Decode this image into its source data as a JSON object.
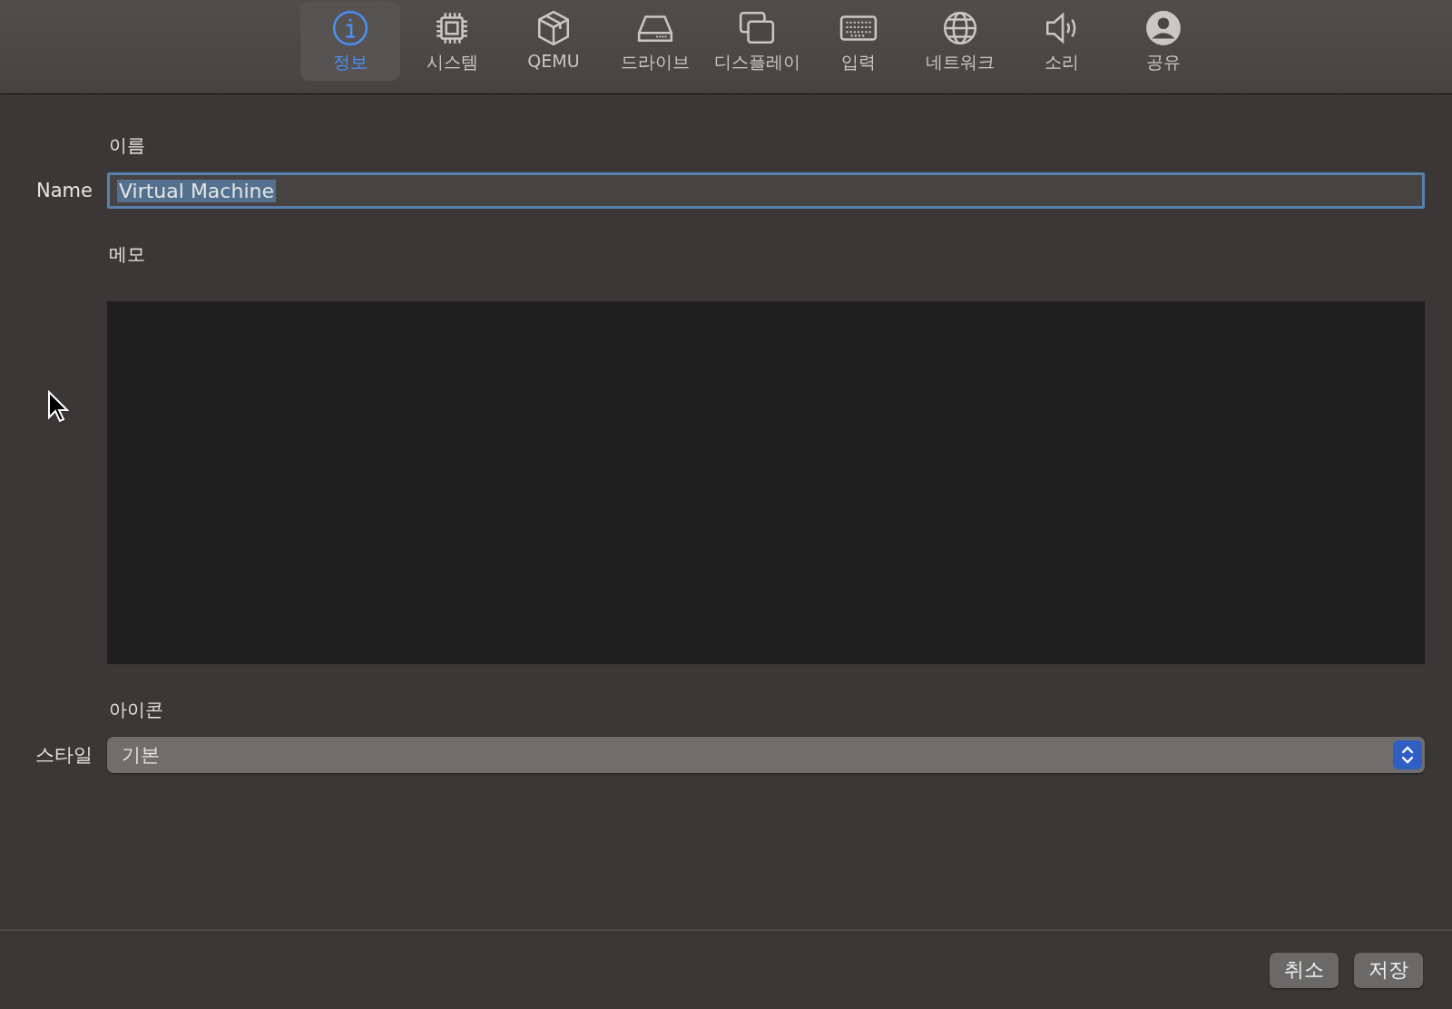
{
  "toolbar": {
    "tabs": [
      {
        "label": "정보",
        "selected": true
      },
      {
        "label": "시스템",
        "selected": false
      },
      {
        "label": "QEMU",
        "selected": false
      },
      {
        "label": "드라이브",
        "selected": false
      },
      {
        "label": "디스플레이",
        "selected": false
      },
      {
        "label": "입력",
        "selected": false
      },
      {
        "label": "네트워크",
        "selected": false
      },
      {
        "label": "소리",
        "selected": false
      },
      {
        "label": "공유",
        "selected": false
      }
    ]
  },
  "sections": [
    {
      "kind": "text",
      "heading": "이름",
      "label": "Name",
      "value": "Virtual Machine",
      "focused": true,
      "text_selected": true
    },
    {
      "kind": "memo",
      "heading": "메모"
    },
    {
      "kind": "popup",
      "heading": "아이콘",
      "label": "스타일",
      "value": "기본"
    }
  ],
  "buttons": [
    "취소",
    "저장"
  ]
}
